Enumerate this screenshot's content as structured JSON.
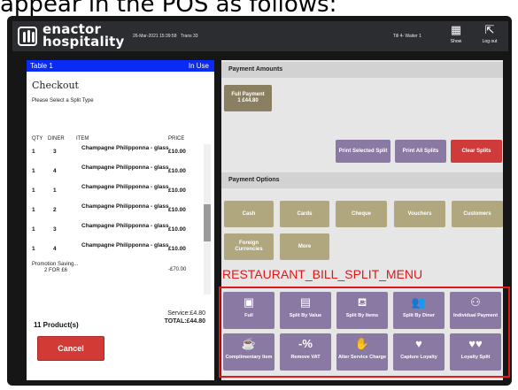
{
  "caption": "appear in the POS as follows:",
  "topbar": {
    "logo_line1": "enactor",
    "logo_line2": "hospitality",
    "datetime": "26-Mar-2021 15:39:58",
    "trans": "Trans 33",
    "till": "Till 4- Waiter 1",
    "show_label": "Show",
    "logout_label": "Log out",
    "icons": [
      "grid-icon",
      "logout-icon"
    ]
  },
  "order": {
    "table_name": "Table 1",
    "table_status": "In Use",
    "title": "Checkout",
    "instruction": "Please Select a Split Type",
    "columns": [
      "QTY",
      "DINER",
      "ITEM",
      "PRICE"
    ],
    "lines": [
      {
        "qty": "1",
        "diner": "3",
        "item": "Champagne Philipponna - glass",
        "price": "£10.00"
      },
      {
        "qty": "1",
        "diner": "4",
        "item": "Champagne Philipponna - glass",
        "price": "£10.00"
      },
      {
        "qty": "1",
        "diner": "1",
        "item": "Champagne Philipponna - glass",
        "price": "£10.00"
      },
      {
        "qty": "1",
        "diner": "2",
        "item": "Champagne Philipponna - glass",
        "price": "£10.00"
      },
      {
        "qty": "1",
        "diner": "3",
        "item": "Champagne Philipponna - glass",
        "price": "£10.00"
      },
      {
        "qty": "1",
        "diner": "4",
        "item": "Champagne Philipponna - glass",
        "price": "£10.00"
      }
    ],
    "promo_title": "Promotion Saving...",
    "promo_desc": "2 FOR £6",
    "promo_price": "-£70.00",
    "service": "Service:£4.80",
    "total": "TOTAL:£44.80",
    "product_count": "11 Product(s)",
    "cancel_label": "Cancel"
  },
  "payment": {
    "amounts_header": "Payment Amounts",
    "full_payment_label": "Full Payment",
    "full_payment_value": "1 £44.80",
    "print_selected_label": "Print Selected Split",
    "print_all_label": "Print All Splits",
    "clear_label": "Clear Splits",
    "options_header": "Payment Options",
    "options": [
      "Cash",
      "Cards",
      "Cheque",
      "Vouchers",
      "Customers",
      "Foreign Currencies",
      "More"
    ]
  },
  "split_menu": {
    "annotation": "RESTAURANT_BILL_SPLIT_MENU",
    "tiles": [
      {
        "label": "Full",
        "icon": "full-icon",
        "glyph": "▣"
      },
      {
        "label": "Split By Value",
        "icon": "split-by-value-icon",
        "glyph": "▤"
      },
      {
        "label": "Split By Items",
        "icon": "split-by-items-icon",
        "glyph": "⛾"
      },
      {
        "label": "Split By Diner",
        "icon": "split-by-diner-icon",
        "glyph": "👥"
      },
      {
        "label": "Individual Payment",
        "icon": "individual-payment-icon",
        "glyph": "⚇"
      },
      {
        "label": "Complimentary Item",
        "icon": "complimentary-item-icon",
        "glyph": "☕"
      },
      {
        "label": "Remove VAT",
        "icon": "remove-vat-icon",
        "glyph": "-%"
      },
      {
        "label": "Alter Service Charge",
        "icon": "alter-service-charge-icon",
        "glyph": "✋"
      },
      {
        "label": "Capture Loyalty",
        "icon": "capture-loyalty-icon",
        "glyph": "♥"
      },
      {
        "label": "Loyalty Split",
        "icon": "loyalty-split-icon",
        "glyph": "♥♥"
      }
    ]
  },
  "colors": {
    "table_header": "#0a2bf5",
    "olive_button": "#b0a77f",
    "purple_button": "#8a7aa3",
    "red_button": "#cf3b3a",
    "annotation_red": "#e01818"
  }
}
